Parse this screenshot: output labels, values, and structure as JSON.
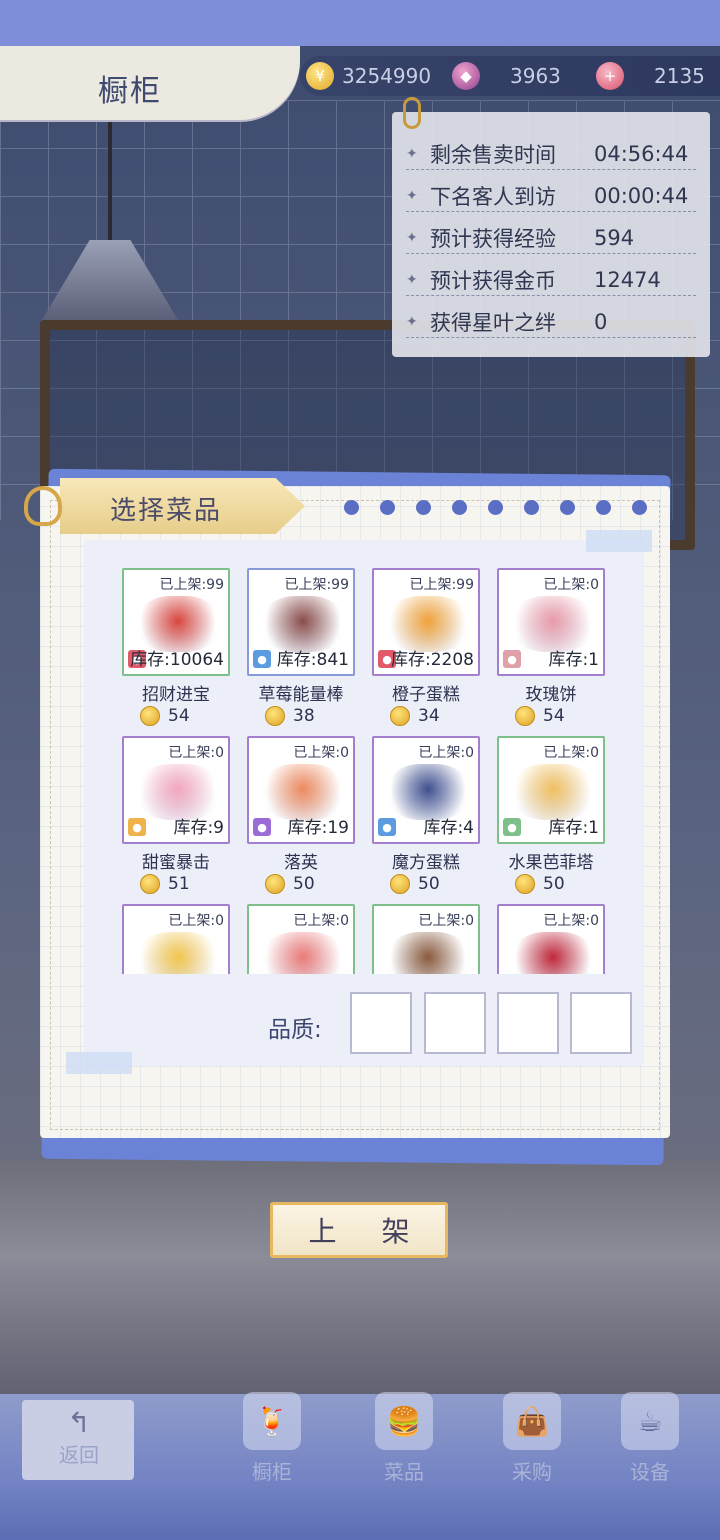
{
  "header": {
    "title": "橱柜",
    "gold": "3254990",
    "gems": "3963",
    "hearts": "2135"
  },
  "info": [
    {
      "label": "剩余售卖时间",
      "value": "04:56:44"
    },
    {
      "label": "下名客人到访",
      "value": "00:00:44"
    },
    {
      "label": "预计获得经验",
      "value": "594"
    },
    {
      "label": "预计获得金币",
      "value": "12474"
    },
    {
      "label": "获得星叶之绊",
      "value": "0"
    }
  ],
  "dialog": {
    "title": "选择菜品",
    "quality_label": "品质:",
    "confirm_label": "上 架"
  },
  "dishes": [
    {
      "shelf": "已上架:99",
      "stock": "库存:10064",
      "name": "招财进宝",
      "price": "54",
      "border": "g",
      "badge_color": "#e05a6a",
      "food_color": "#d9473f"
    },
    {
      "shelf": "已上架:99",
      "stock": "库存:841",
      "name": "草莓能量棒",
      "price": "38",
      "border": "b",
      "badge_color": "#5b9be0",
      "food_color": "#8a4d4a"
    },
    {
      "shelf": "已上架:99",
      "stock": "库存:2208",
      "name": "橙子蛋糕",
      "price": "34",
      "border": "p",
      "badge_color": "#e05a6a",
      "food_color": "#f0a23a"
    },
    {
      "shelf": "已上架:0",
      "stock": "库存:1",
      "name": "玫瑰饼",
      "price": "54",
      "border": "p",
      "badge_color": "#e0a0a8",
      "food_color": "#e89aa8"
    },
    {
      "shelf": "已上架:0",
      "stock": "库存:9",
      "name": "甜蜜暴击",
      "price": "51",
      "border": "p",
      "badge_color": "#f0b24a",
      "food_color": "#f3a6be"
    },
    {
      "shelf": "已上架:0",
      "stock": "库存:19",
      "name": "落英",
      "price": "50",
      "border": "p",
      "badge_color": "#9b6bd6",
      "food_color": "#ee8a5e"
    },
    {
      "shelf": "已上架:0",
      "stock": "库存:4",
      "name": "魔方蛋糕",
      "price": "50",
      "border": "p",
      "badge_color": "#5b9be0",
      "food_color": "#3f4f8e"
    },
    {
      "shelf": "已上架:0",
      "stock": "库存:1",
      "name": "水果芭菲塔",
      "price": "50",
      "border": "g",
      "badge_color": "#7ec08a",
      "food_color": "#f0c060"
    },
    {
      "shelf": "已上架:0",
      "stock": "",
      "name": "",
      "price": "",
      "border": "p",
      "badge_color": "#e05a6a",
      "food_color": "#f2c54e"
    },
    {
      "shelf": "已上架:0",
      "stock": "",
      "name": "",
      "price": "",
      "border": "g",
      "badge_color": "#7ec08a",
      "food_color": "#ea7b78"
    },
    {
      "shelf": "已上架:0",
      "stock": "",
      "name": "",
      "price": "",
      "border": "g",
      "badge_color": "#7ec08a",
      "food_color": "#8a5a3c"
    },
    {
      "shelf": "已上架:0",
      "stock": "",
      "name": "",
      "price": "",
      "border": "p",
      "badge_color": "#e05a6a",
      "food_color": "#c0283a"
    }
  ],
  "nav": {
    "back": "返回",
    "items": [
      "橱柜",
      "菜品",
      "采购",
      "设备"
    ]
  }
}
